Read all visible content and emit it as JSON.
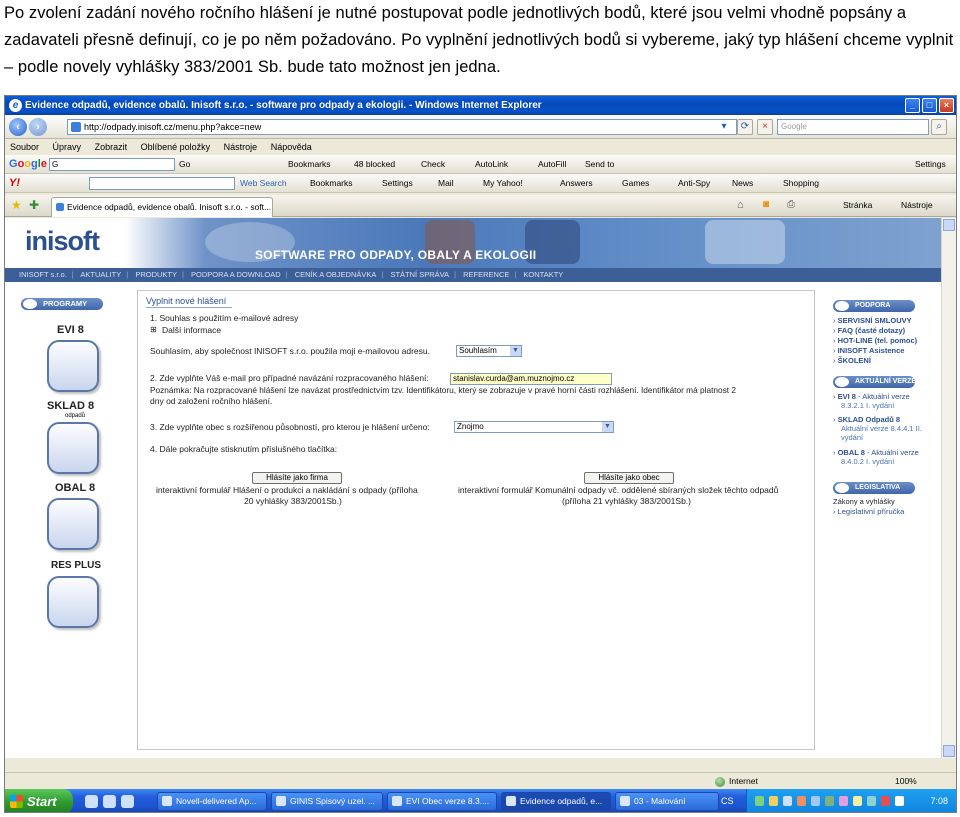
{
  "doc": {
    "paragraph": "Po zvolení zadání nového ročního hlášení je nutné postupovat podle jednotlivých bodů, které jsou velmi vhodně popsány a zadavateli přesně definují, co je po něm požadováno. Po vyplnění jednotlivých bodů si vybereme, jaký typ hlášení chceme vyplnit – podle novely vyhlášky 383/2001 Sb. bude tato možnost jen jedna."
  },
  "browser": {
    "title": "Evidence odpadů, evidence obalů. Inisoft s.r.o. - software pro odpady a ekologii. - Windows Internet Explorer",
    "url": "http://odpady.inisoft.cz/menu.php?akce=new",
    "search_placeholder": "Google",
    "menu": [
      "Soubor",
      "Úpravy",
      "Zobrazit",
      "Oblíbené položky",
      "Nástroje",
      "Nápověda"
    ],
    "google_bar": {
      "logo": "Google",
      "input": "G",
      "go": "Go",
      "bookmarks": "Bookmarks",
      "blocked": "48 blocked",
      "check": "Check",
      "autolink": "AutoLink",
      "autofill": "AutoFill",
      "sendto": "Send to",
      "settings": "Settings"
    },
    "yahoo_bar": {
      "logo": "Y!",
      "web_search": "Web Search",
      "bookmarks": "Bookmarks",
      "settings": "Settings",
      "mail": "Mail",
      "my_yahoo": "My Yahoo!",
      "answers": "Answers",
      "games": "Games",
      "antispy": "Anti-Spy",
      "news": "News",
      "shopping": "Shopping"
    },
    "tab_label": "Evidence odpadů, evidence obalů. Inisoft s.r.o. - soft...",
    "tab_tools": [
      "Stránka",
      "Nástroje"
    ],
    "status_zone": "Internet",
    "status_zoom": "100%"
  },
  "site": {
    "logo": "inisoft",
    "banner_text": "SOFTWARE PRO ODPADY, OBALY A EKOLOGII",
    "nav": [
      "INISOFT s.r.o.",
      "AKTUALITY",
      "PRODUKTY",
      "PODPORA A DOWNLOAD",
      "CENÍK A OBJEDNÁVKA",
      "STÁTNÍ SPRÁVA",
      "REFERENCE",
      "KONTAKTY"
    ],
    "programs_label": "PROGRAMY",
    "products": [
      "EVI 8",
      "SKLAD 8",
      "odpadů",
      "OBAL 8",
      "RES PLUS"
    ],
    "form": {
      "title": "Vyplnit nové hlášení",
      "step1": "1. Souhlas s použitím e-mailové adresy",
      "more_info": "Další informace",
      "consent_text": "Souhlasím, aby společnost INISOFT s.r.o. použila moji e-mailovou adresu.",
      "consent_value": "Souhlasím",
      "step2": "2. Zde vyplňte Váš e-mail pro případné navázání rozpracovaného hlášení:",
      "email_value": "stanislav.curda@am.muznojmo.cz",
      "note1": "Poznámka: Na rozpracované hlášení lze navázat prostřednictvím tzv. Identifikátoru, který se zobrazuje v pravé horní části rozhlášení. Identifikátor má platnost 2",
      "note2": "dny od založení ročního hlášení.",
      "step3": "3. Zde vyplňte obec s rozšířenou působností, pro kterou je hlášení určeno:",
      "obec_value": "Znojmo",
      "step4": "4. Dále pokračujte stisknutím příslušného tlačítka:",
      "btn_firma": "Hlásíte jako firma",
      "btn_obec": "Hlásíte jako obec",
      "firma_desc1": "interaktivní formulář Hlášení o produkci a nakládání s odpady (příloha",
      "firma_desc2": "20 vyhlášky 383/2001Sb.)",
      "obec_desc1": "interaktivní formulář Komunální odpady vč. oddělené sbíraných složek těchto odpadů",
      "obec_desc2": "(příloha 21 vyhlášky 383/2001Sb.)"
    },
    "right": {
      "podpora": "PODPORA",
      "podpora_links": [
        "SERVISNÍ SMLOUVY",
        "FAQ (časté dotazy)",
        "HOT-LINE (tel. pomoc)",
        "INISOFT Asistence",
        "ŠKOLENÍ"
      ],
      "aktualni": "AKTUÁLNÍ VERZE",
      "v1_name": "EVI 8",
      "v1_rest": " - Aktuální verze",
      "v1_sub": "8.3.2.1 I. vydání",
      "v2_name": "SKLAD Odpadů 8",
      "v2_sub": "Aktuální verze 8.4.4.1 II. vydání",
      "v3_name": "OBAL 8",
      "v3_rest": " - Aktuální verze",
      "v3_sub": "8.4.0.2 I. vydání",
      "legislativa": "LEGISLATIVA",
      "leg1": "Zákony a vyhlášky",
      "leg2": "Legislativní příručka"
    }
  },
  "taskbar": {
    "start": "Start",
    "tasks": [
      "Novell-delivered Ap...",
      "GINIS Spisový uzel. ...",
      "EVI Obec verze 8.3....",
      "Evidence odpadů, e...",
      "03 - Malování"
    ],
    "lang": "CS",
    "clock": "7:08"
  }
}
